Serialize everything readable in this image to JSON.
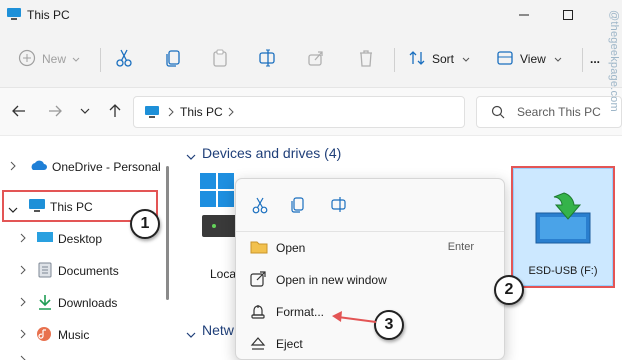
{
  "window": {
    "title": "This PC"
  },
  "toolbar": {
    "new_label": "New",
    "sort_label": "Sort",
    "view_label": "View",
    "more_label": "..."
  },
  "address": {
    "location": "This PC",
    "search_placeholder": "Search This PC"
  },
  "nav": {
    "items": [
      {
        "label": "OneDrive - Personal"
      },
      {
        "label": "This PC"
      },
      {
        "label": "Desktop"
      },
      {
        "label": "Documents"
      },
      {
        "label": "Downloads"
      },
      {
        "label": "Music"
      }
    ]
  },
  "main": {
    "devices_header": "Devices and drives (4)",
    "network_header": "Netw",
    "local_drive_label": "Loca",
    "usb_drive_label": "ESD-USB (F:)"
  },
  "context_menu": {
    "items": [
      {
        "label": "Open",
        "shortcut": "Enter",
        "icon": "folder-open-icon"
      },
      {
        "label": "Open in new window",
        "shortcut": "",
        "icon": "open-new-window-icon"
      },
      {
        "label": "Format...",
        "shortcut": "",
        "icon": "format-icon"
      },
      {
        "label": "Eject",
        "shortcut": "",
        "icon": "eject-icon"
      }
    ]
  },
  "annotations": {
    "step1": "1",
    "step2": "2",
    "step3": "3"
  },
  "watermark": "@thegeekpage.com",
  "colors": {
    "accent": "#0067c0",
    "annotation": "#e35555",
    "selection": "#cce8ff"
  }
}
